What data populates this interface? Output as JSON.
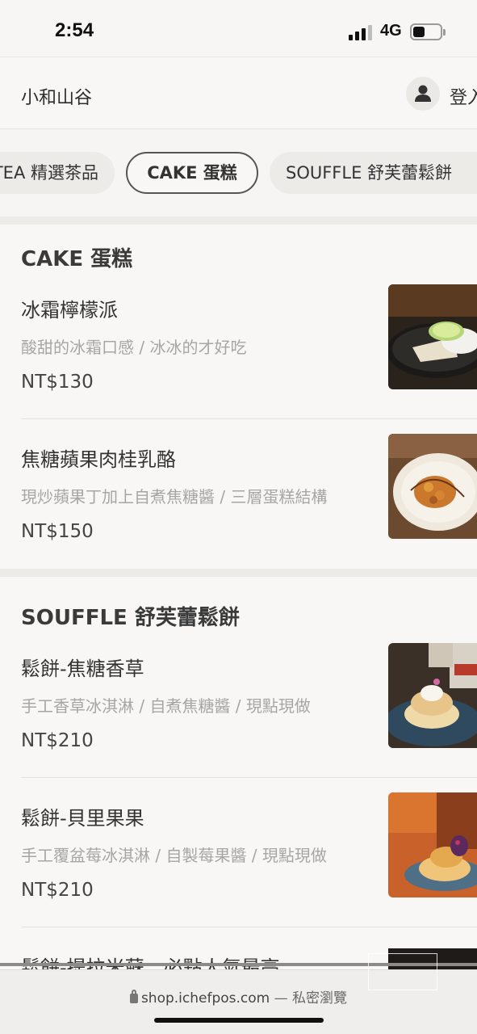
{
  "status_bar": {
    "time": "2:54",
    "network": "4G"
  },
  "header": {
    "store_name": "小和山谷",
    "login_label": "登入"
  },
  "tabs": [
    {
      "label": "TEA 精選茶品"
    },
    {
      "label": "CAKE 蛋糕",
      "selected": true
    },
    {
      "label": "SOUFFLE 舒芙蕾鬆餅"
    }
  ],
  "sections": [
    {
      "title": "CAKE 蛋糕",
      "items": [
        {
          "name": "冰霜檸檬派",
          "description": "酸甜的冰霜口感 / 冰冰的才好吃",
          "price": "NT$130"
        },
        {
          "name": "焦糖蘋果肉桂乳酪",
          "description": "現炒蘋果丁加上自煮焦糖醬 / 三層蛋糕結構",
          "price": "NT$150"
        }
      ]
    },
    {
      "title": "SOUFFLE 舒芙蕾鬆餅",
      "items": [
        {
          "name": "鬆餅-焦糖香草",
          "description": "手工香草冰淇淋 / 自煮焦糖醬 / 現點現做",
          "price": "NT$210"
        },
        {
          "name": "鬆餅-貝里果果",
          "description": "手工覆盆莓冰淇淋 / 自製莓果醬 / 現點現做",
          "price": "NT$210"
        },
        {
          "name": "鬆餅-提拉米蘇。必點人氣最高"
        }
      ]
    }
  ],
  "browser": {
    "url": "shop.ichefpos.com",
    "mode": " — 私密瀏覽"
  },
  "colors": {
    "background": "#f4f3f1",
    "selected_tab_border": "#555555",
    "description_text": "#a8a6a2"
  }
}
